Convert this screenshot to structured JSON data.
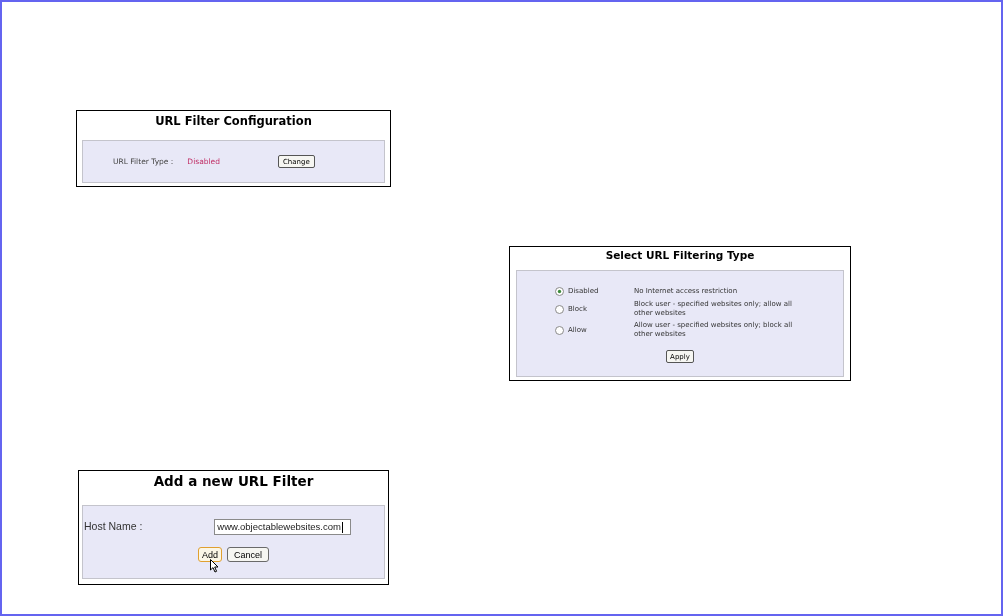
{
  "filter_configuration": {
    "title": "URL Filter Configuration",
    "label": "URL Filter Type :",
    "value": "Disabled",
    "button": "Change"
  },
  "filtering_type": {
    "title": "Select URL Filtering Type",
    "options": [
      {
        "label": "Disabled",
        "description": "No Internet access restriction",
        "selected": true
      },
      {
        "label": "Block",
        "description": "Block user - specified websites only; allow all other websites",
        "selected": false
      },
      {
        "label": "Allow",
        "description": "Allow user - specified websites only; block all other websites",
        "selected": false
      }
    ],
    "button": "Apply"
  },
  "add_filter": {
    "title": "Add a new URL Filter",
    "host_name": {
      "label": "Host Name :",
      "value": "www.objectablewebsites.com"
    },
    "buttons": [
      {
        "label": "Add",
        "hovered": true
      },
      {
        "label": "Cancel",
        "hovered": false
      }
    ]
  }
}
